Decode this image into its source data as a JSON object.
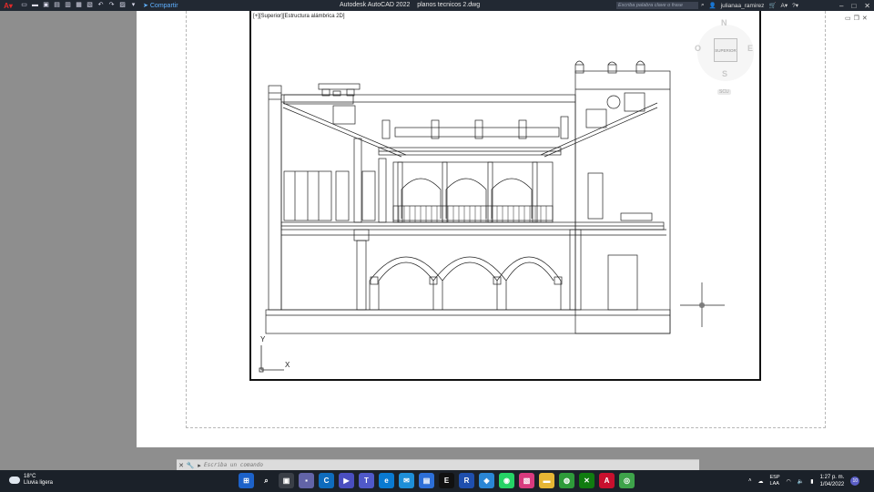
{
  "app": {
    "title": "Autodesk AutoCAD 2022",
    "file": "planos tecnicos 2.dwg",
    "search_placeholder": "Escriba palabra clave o frase",
    "user": "julianaa_ramirez",
    "share_label": "Compartir"
  },
  "viewport": {
    "label": "[+][Superior][Estructura alámbrica 2D]"
  },
  "viewcube": {
    "north": "N",
    "south": "S",
    "east": "E",
    "west": "O",
    "face": "SUPERIOR",
    "wcs": "SCU"
  },
  "ucs": {
    "y": "Y",
    "x": "X"
  },
  "command": {
    "placeholder": "Escriba un comando"
  },
  "taskbar": {
    "temp": "18°C",
    "weather": "Lluvia ligera",
    "lang": "ESP",
    "lang_sub": "LAA",
    "time": "1:27 p. m.",
    "date": "1/04/2022",
    "notifications": "10"
  },
  "colors": {
    "accent": "#e02a2a",
    "share": "#5fb0ff",
    "taskbar": "#1b2129"
  }
}
